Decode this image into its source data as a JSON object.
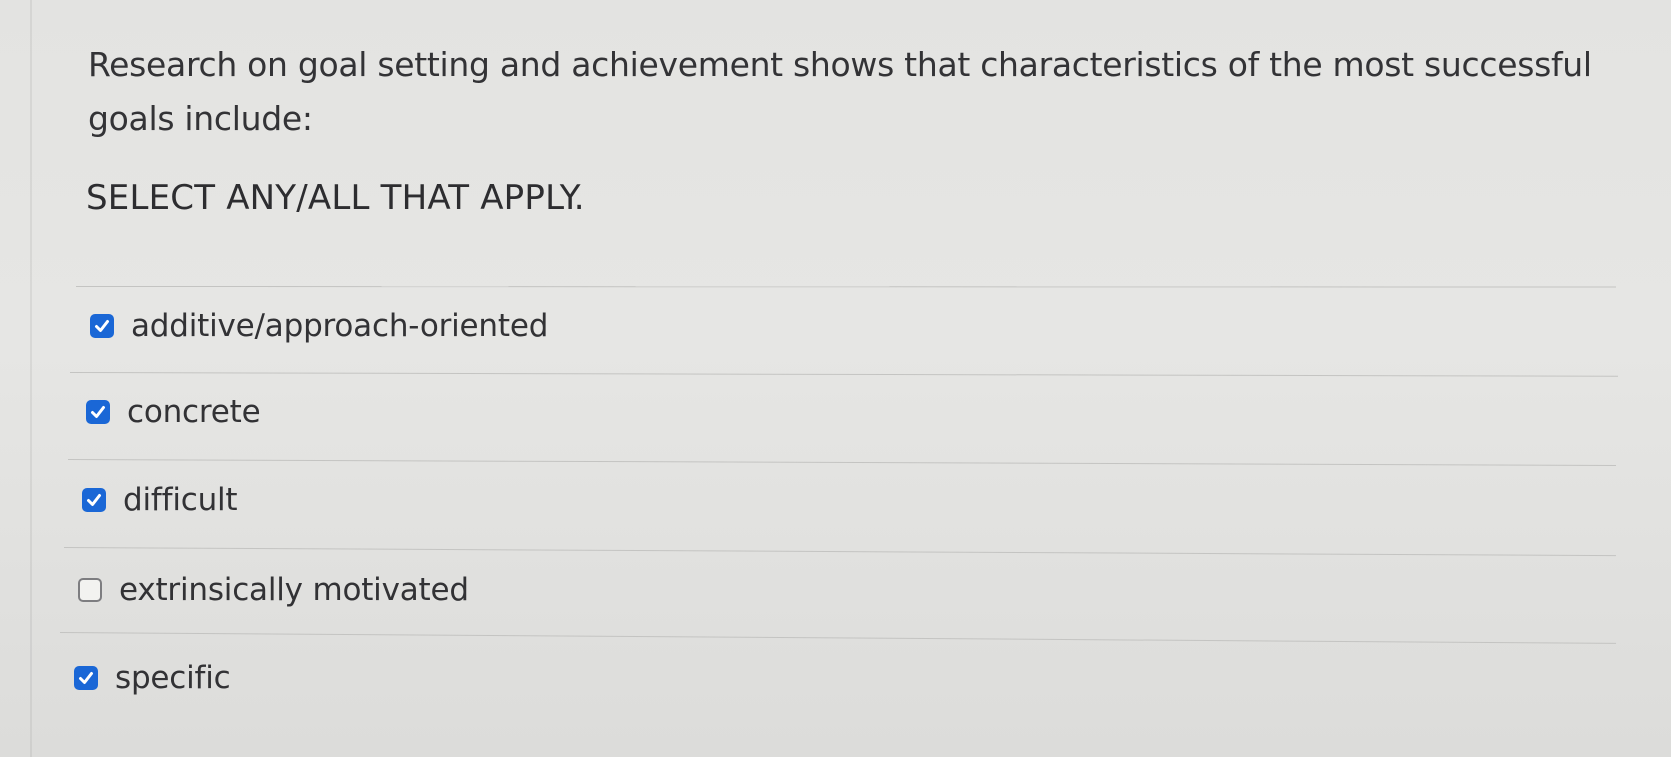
{
  "question": {
    "text": "Research on goal setting and achievement shows that characteristics of the most successful goals include:",
    "instruction": "SELECT ANY/ALL THAT APPLY."
  },
  "options": [
    {
      "label": "additive/approach-oriented",
      "checked": true
    },
    {
      "label": "concrete",
      "checked": true
    },
    {
      "label": "difficult",
      "checked": true
    },
    {
      "label": "extrinsically motivated",
      "checked": false
    },
    {
      "label": "specific",
      "checked": true
    }
  ],
  "colors": {
    "checkbox_checked": "#1a67d6",
    "checkbox_unchecked_border": "#7d7d80",
    "text": "#323235"
  },
  "icons": {
    "checked": "checkmark-icon"
  }
}
